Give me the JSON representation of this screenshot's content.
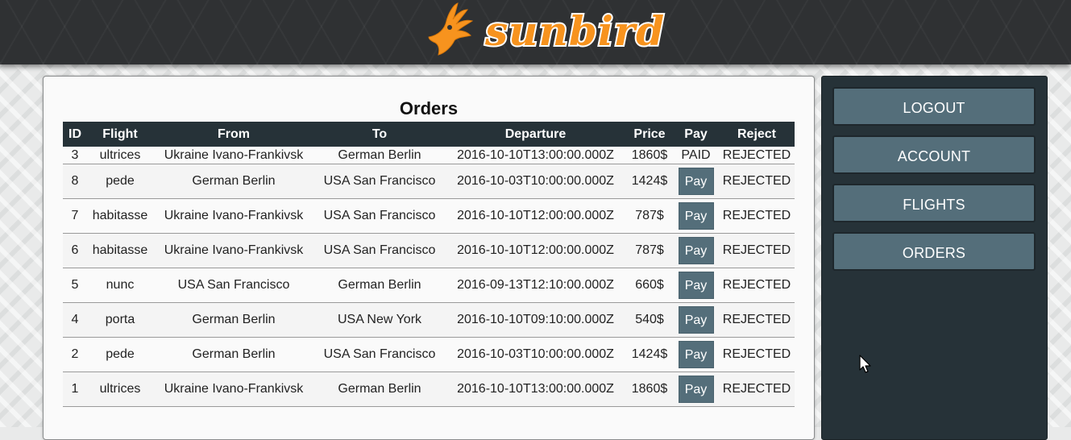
{
  "brand": {
    "name": "sunbird"
  },
  "page_title": "Orders",
  "table": {
    "headers": [
      "ID",
      "Flight",
      "From",
      "To",
      "Departure",
      "Price",
      "Pay",
      "Reject"
    ],
    "pay_label": "Pay",
    "rows": [
      {
        "id": "3",
        "flight": "ultrices",
        "from": "Ukraine Ivano-Frankivsk",
        "to": "German Berlin",
        "departure": "2016-10-10T13:00:00.000Z",
        "price": "1860$",
        "pay": "PAID",
        "reject": "REJECTED"
      },
      {
        "id": "8",
        "flight": "pede",
        "from": "German Berlin",
        "to": "USA San Francisco",
        "departure": "2016-10-03T10:00:00.000Z",
        "price": "1424$",
        "pay": "Pay",
        "reject": "REJECTED"
      },
      {
        "id": "7",
        "flight": "habitasse",
        "from": "Ukraine Ivano-Frankivsk",
        "to": "USA San Francisco",
        "departure": "2016-10-10T12:00:00.000Z",
        "price": "787$",
        "pay": "Pay",
        "reject": "REJECTED"
      },
      {
        "id": "6",
        "flight": "habitasse",
        "from": "Ukraine Ivano-Frankivsk",
        "to": "USA San Francisco",
        "departure": "2016-10-10T12:00:00.000Z",
        "price": "787$",
        "pay": "Pay",
        "reject": "REJECTED"
      },
      {
        "id": "5",
        "flight": "nunc",
        "from": "USA San Francisco",
        "to": "German Berlin",
        "departure": "2016-09-13T12:10:00.000Z",
        "price": "660$",
        "pay": "Pay",
        "reject": "REJECTED"
      },
      {
        "id": "4",
        "flight": "porta",
        "from": "German Berlin",
        "to": "USA New York",
        "departure": "2016-10-10T09:10:00.000Z",
        "price": "540$",
        "pay": "Pay",
        "reject": "REJECTED"
      },
      {
        "id": "2",
        "flight": "pede",
        "from": "German Berlin",
        "to": "USA San Francisco",
        "departure": "2016-10-03T10:00:00.000Z",
        "price": "1424$",
        "pay": "Pay",
        "reject": "REJECTED"
      },
      {
        "id": "1",
        "flight": "ultrices",
        "from": "Ukraine Ivano-Frankivsk",
        "to": "German Berlin",
        "departure": "2016-10-10T13:00:00.000Z",
        "price": "1860$",
        "pay": "Pay",
        "reject": "REJECTED"
      }
    ]
  },
  "sidebar": {
    "items": [
      {
        "label": "LOGOUT"
      },
      {
        "label": "ACCOUNT"
      },
      {
        "label": "FLIGHTS"
      },
      {
        "label": "ORDERS"
      }
    ]
  },
  "colors": {
    "header_bg": "#2f3133",
    "table_header_bg": "#263238",
    "sidebar_bg": "#263238",
    "button_bg": "#546e7a",
    "logo_orange": "#f7931e"
  }
}
